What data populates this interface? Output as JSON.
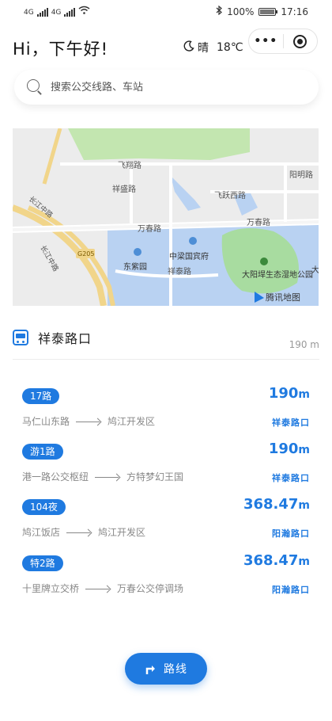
{
  "status_bar": {
    "network_left": "4G",
    "network_right": "4G",
    "battery_percent": "100%",
    "battery_level": 1.0,
    "time": "17:16"
  },
  "header": {
    "greeting": "Hi，下午好!",
    "weather_condition": "晴",
    "temperature": "18℃",
    "capsule_more": "•••"
  },
  "search": {
    "placeholder": "搜索公交线路、车站"
  },
  "map": {
    "roads": [
      "飞翔路",
      "祥盛路",
      "飞跃西路",
      "阳明路",
      "万春路",
      "万春路",
      "祥泰路",
      "G205",
      "长江中路",
      "长江中路"
    ],
    "pois": [
      "东紫园",
      "中梁国宾府",
      "大阳垾生态湿地公园",
      "大"
    ],
    "provider": "腾讯地图"
  },
  "stop": {
    "name": "祥泰路口",
    "distance": "190 m"
  },
  "routes": [
    {
      "line": "17路",
      "from": "马仁山东路",
      "to": "鸠江开发区",
      "distance": "190",
      "unit": "m",
      "stop": "祥泰路口"
    },
    {
      "line": "游1路",
      "from": "港一路公交枢纽",
      "to": "方特梦幻王国",
      "distance": "190",
      "unit": "m",
      "stop": "祥泰路口"
    },
    {
      "line": "104夜",
      "from": "鸠江饭店",
      "to": "鸠江开发区",
      "distance": "368.47",
      "unit": "m",
      "stop": "阳瀚路口"
    },
    {
      "line": "特2路",
      "from": "十里牌立交桥",
      "to": "万春公交停调场",
      "distance": "368.47",
      "unit": "m",
      "stop": "阳瀚路口"
    }
  ],
  "route_button": {
    "label": "路线"
  },
  "colors": {
    "accent": "#1f7ae0",
    "map_water": "#b9d2f2",
    "map_green": "#c3e6b0"
  }
}
